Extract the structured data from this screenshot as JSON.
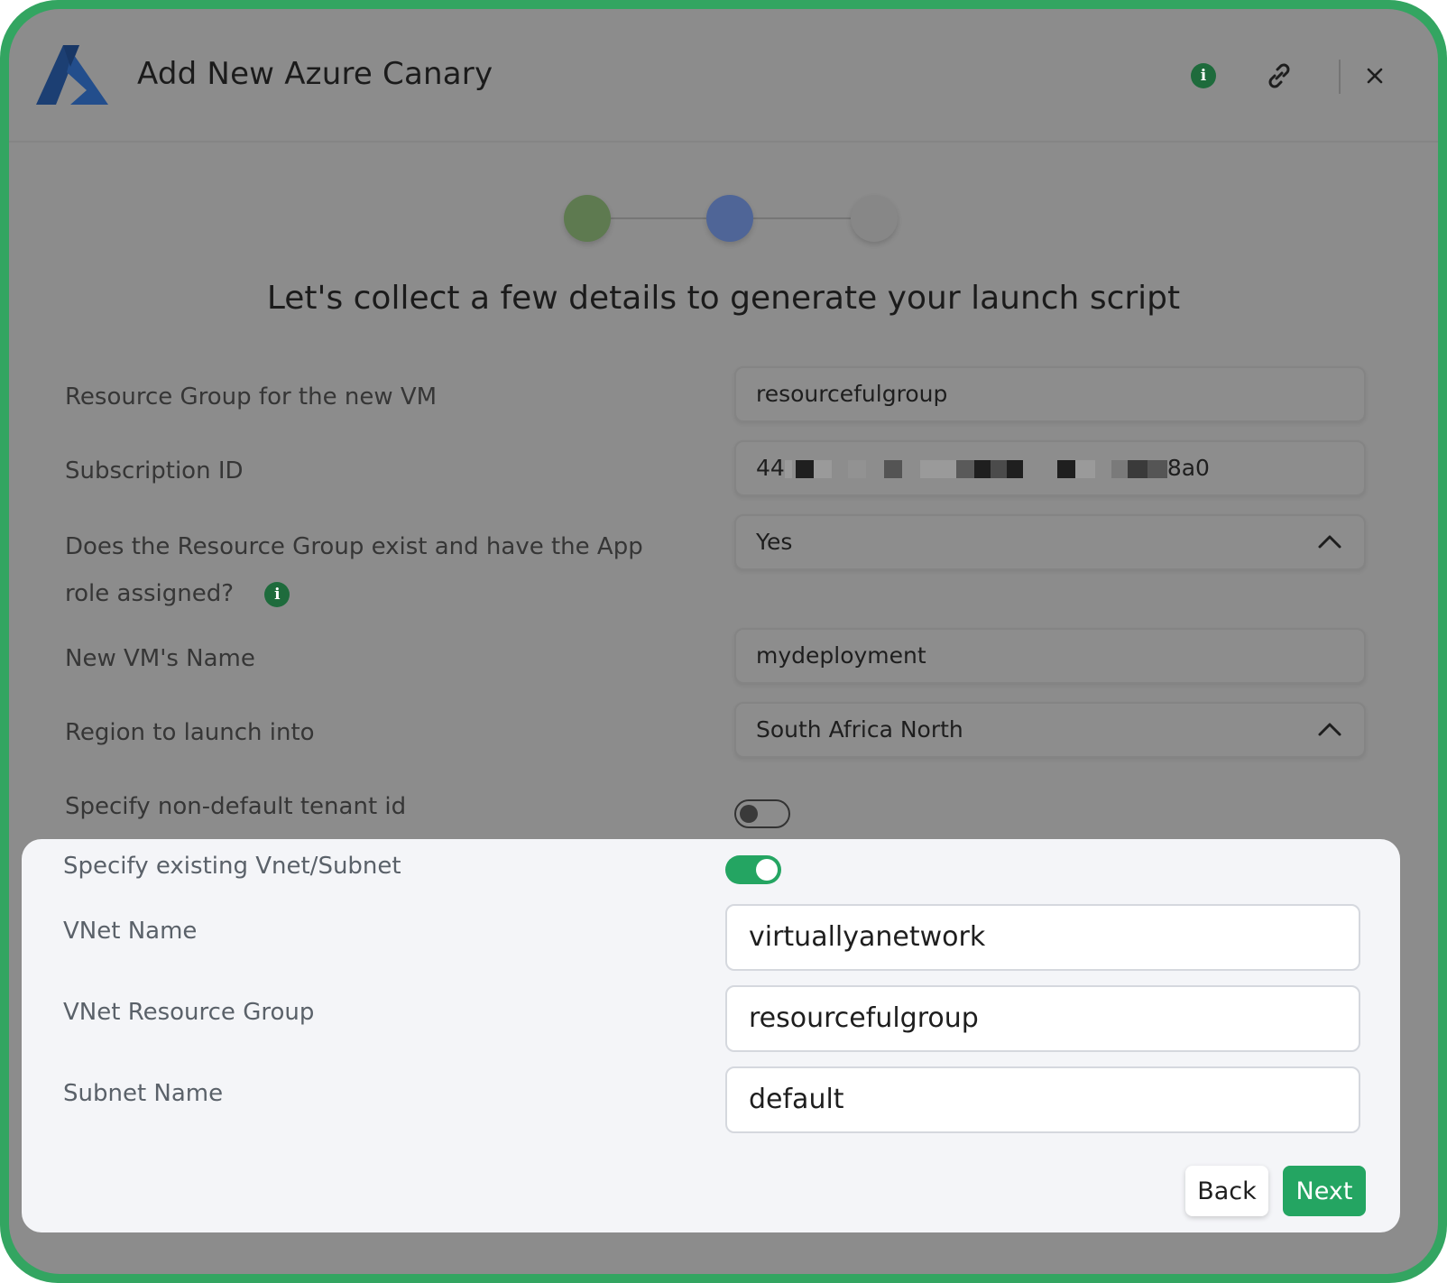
{
  "header": {
    "title": "Add New Azure Canary",
    "logo_icon": "azure-logo-icon",
    "info_icon": "info-icon",
    "link_icon": "link-icon",
    "close_icon": "close-icon",
    "close_glyph": "✕"
  },
  "stepper": {
    "steps": [
      {
        "state": "complete",
        "color": "#5e7a50"
      },
      {
        "state": "current",
        "color": "#4f6597"
      },
      {
        "state": "upcoming",
        "color": "#878787"
      }
    ]
  },
  "subtitle": "Let's collect a few details to generate your launch script",
  "form": {
    "resource_group": {
      "label": "Resource Group for the new VM",
      "value": "resourcefulgroup"
    },
    "subscription_id": {
      "label": "Subscription ID",
      "value_prefix": "44",
      "value_suffix": "8a0"
    },
    "rg_exists": {
      "label_line1": "Does the Resource Group exist and have the App",
      "label_line2": "role assigned?",
      "value": "Yes",
      "info_glyph": "i"
    },
    "vm_name": {
      "label": "New VM's Name",
      "value": "mydeployment"
    },
    "region": {
      "label": "Region to launch into",
      "value": "South Africa North"
    },
    "tenant_toggle": {
      "label": "Specify non-default tenant id",
      "on": false
    }
  },
  "vnet_panel": {
    "toggle": {
      "label": "Specify existing Vnet/Subnet",
      "on": true
    },
    "vnet_name": {
      "label": "VNet Name",
      "value": "virtuallyanetwork"
    },
    "vnet_rg": {
      "label": "VNet Resource Group",
      "value": "resourcefulgroup"
    },
    "subnet_name": {
      "label": "Subnet Name",
      "value": "default"
    }
  },
  "buttons": {
    "back": "Back",
    "next": "Next"
  },
  "colors": {
    "accent": "#24a562",
    "frame": "#33a561",
    "overlay": "#8c8c8c",
    "info": "#1e6b3c"
  }
}
